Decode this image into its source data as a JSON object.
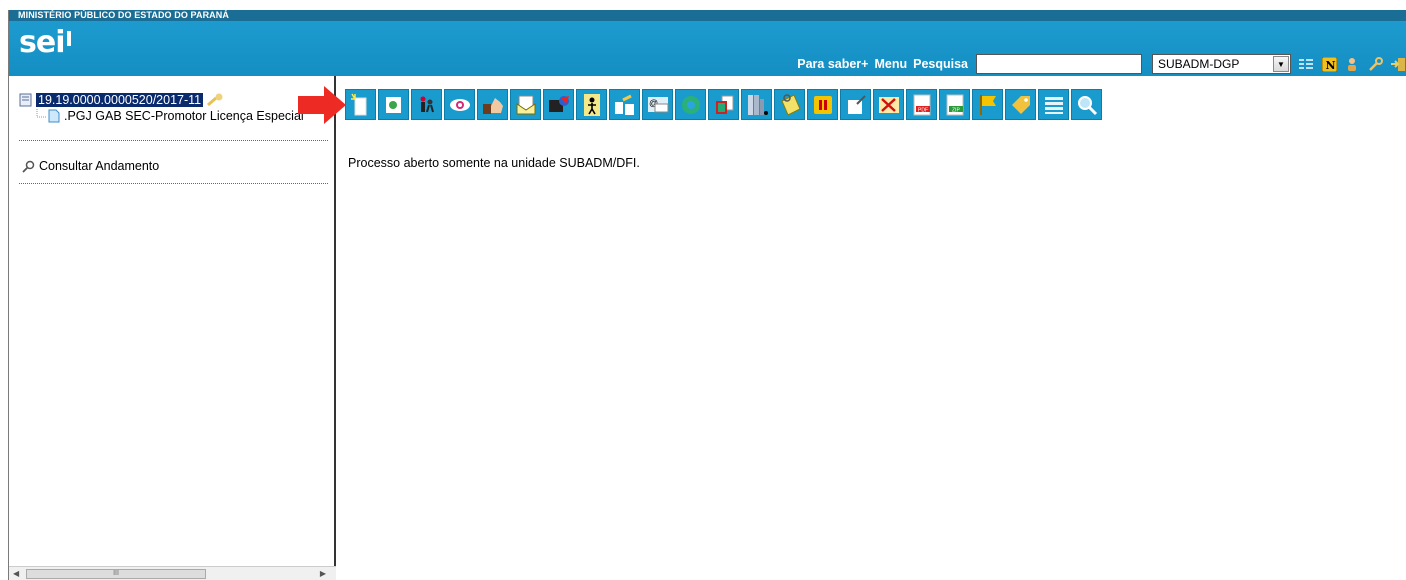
{
  "header": {
    "org_name": "MINISTÉRIO PÚBLICO DO ESTADO DO PARANÁ",
    "logo": "sei",
    "nav": {
      "para_saber": "Para saber+",
      "menu": "Menu",
      "pesquisa": "Pesquisa"
    },
    "search": {
      "value": "",
      "placeholder": ""
    },
    "unit_select": {
      "selected": "SUBADM-DGP"
    },
    "icons": [
      "list-icon",
      "notification-n-icon",
      "user-icon",
      "wrench-icon",
      "exit-icon"
    ],
    "colors": {
      "header_bg": "#1d9bcf",
      "topbar_bg": "#1a6e96"
    }
  },
  "tree": {
    "process_number": "19.19.0000.0000520/2017-11",
    "document_label": ".PGJ GAB SEC-Promotor Licença Especial",
    "consultar": "Consultar Andamento"
  },
  "toolbar": {
    "buttons": [
      "incluir-documento-icon",
      "iniciar-processo-relacionado-icon",
      "atribuir-processo-icon",
      "acompanhamento-especial-icon",
      "gerenciar-disponibilizacoes-icon",
      "enviar-processo-icon",
      "ciencia-icon",
      "atualizar-andamento-icon",
      "credenciais-icon",
      "enviar-email-icon",
      "relacionamentos-icon",
      "duplicar-processo-icon",
      "ordenar-arvore-icon",
      "anotacoes-icon",
      "sobrestar-processo-icon",
      "anexar-processo-icon",
      "excluir-icon",
      "gerar-pdf-icon",
      "gerar-zip-icon",
      "marcador-icon",
      "controle-prazo-icon",
      "pontos-controle-icon",
      "listar-icon",
      "pesquisar-icon"
    ]
  },
  "main": {
    "status_message": "Processo aberto somente na unidade SUBADM/DFI."
  }
}
